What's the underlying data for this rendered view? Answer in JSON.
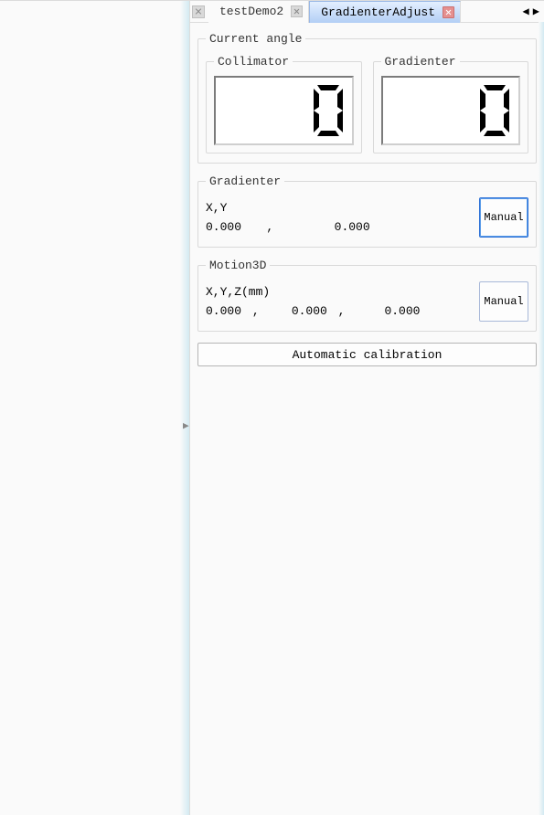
{
  "tabs": {
    "items": [
      {
        "label": "testDemo2",
        "active": false
      },
      {
        "label": "GradienterAdjust",
        "active": true
      }
    ]
  },
  "current_angle": {
    "legend": "Current angle",
    "collimator": {
      "legend": "Collimator",
      "value": "0"
    },
    "gradienter": {
      "legend": "Gradienter",
      "value": "0"
    }
  },
  "gradienter": {
    "legend": "Gradienter",
    "coord_label": "X,Y",
    "x": "0.000",
    "sep": ",",
    "y": "0.000",
    "manual_label": "Manual"
  },
  "motion3d": {
    "legend": "Motion3D",
    "coord_label": "X,Y,Z(mm)",
    "x": "0.000",
    "y": "0.000",
    "z": "0.000",
    "sep": ",",
    "manual_label": "Manual"
  },
  "auto_cal_label": "Automatic calibration"
}
